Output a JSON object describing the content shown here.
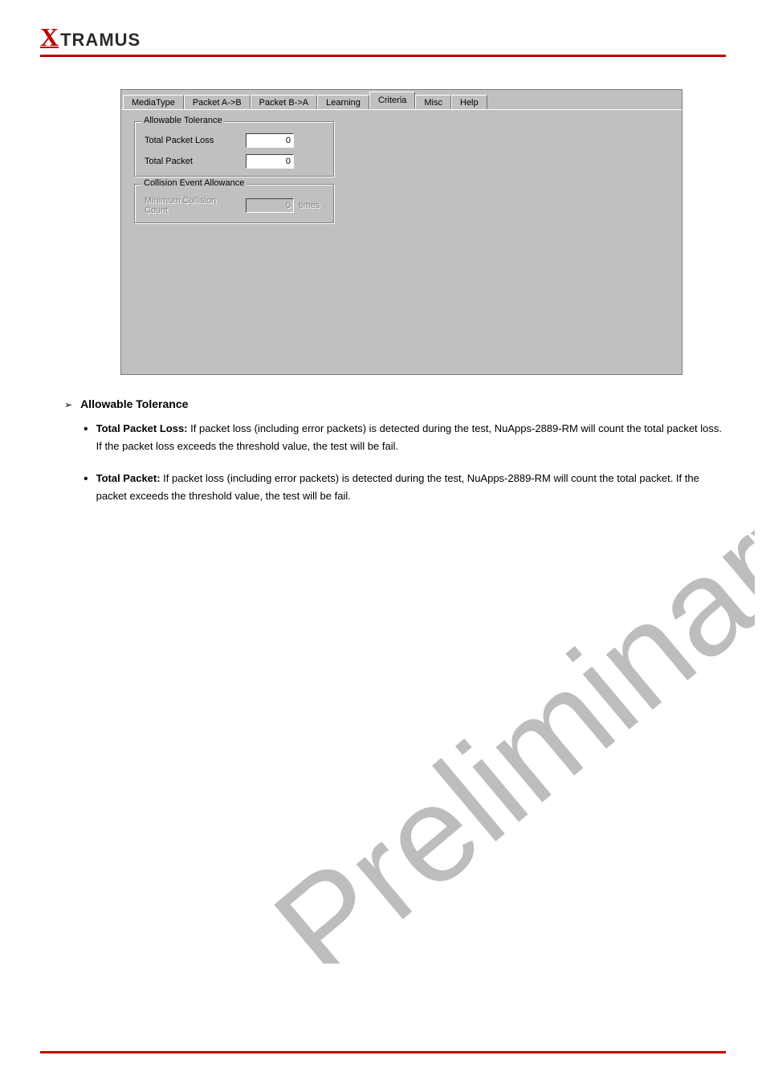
{
  "logo": {
    "x": "X",
    "rest": "TRAMUS"
  },
  "tabs": [
    {
      "label": "MediaType"
    },
    {
      "label": "Packet A->B"
    },
    {
      "label": "Packet B->A"
    },
    {
      "label": "Learning"
    },
    {
      "label": "Criteria"
    },
    {
      "label": "Misc"
    },
    {
      "label": "Help"
    }
  ],
  "active_tab_index": 4,
  "group_allowable": {
    "legend": "Allowable Tolerance",
    "fields": [
      {
        "label": "Total Packet Loss",
        "value": "0"
      },
      {
        "label": "Total Packet",
        "value": "0"
      }
    ]
  },
  "group_collision": {
    "legend": "Collision Event Allowance",
    "label": "Minimum Collision Count",
    "value": "0",
    "unit": "times"
  },
  "doc": {
    "heading": "Allowable Tolerance",
    "item1_label": "Total Packet Loss:",
    "item1_body": " If packet loss (including error packets) is detected during the test, NuApps-2889-RM will count the total packet loss. If the packet loss exceeds the threshold value, the test will be fail.",
    "item2_label": "Total Packet:",
    "item2_body": " If packet loss (including error packets) is detected during the test, NuApps-2889-RM will count the total packet. If the packet exceeds the threshold value, the test will be fail."
  },
  "watermark_text": "Preliminary",
  "footer": {
    "left": "",
    "right": ""
  }
}
